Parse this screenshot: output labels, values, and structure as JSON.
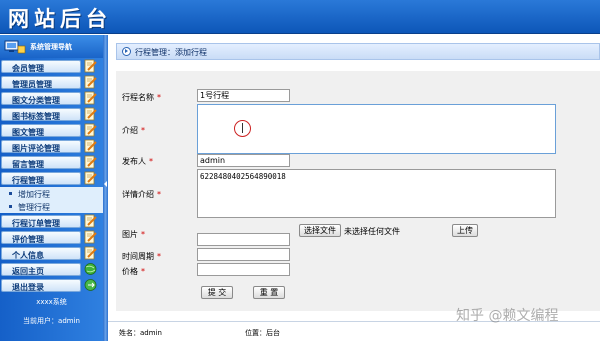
{
  "header": {
    "title": "网站后台"
  },
  "sidebar": {
    "title": "系统管理导航",
    "items": [
      {
        "label": "会员管理"
      },
      {
        "label": "管理员管理"
      },
      {
        "label": "图文分类管理"
      },
      {
        "label": "图书标签管理"
      },
      {
        "label": "图文管理"
      },
      {
        "label": "图片评论管理"
      },
      {
        "label": "留言管理"
      },
      {
        "label": "行程管理"
      }
    ],
    "sub_items": [
      {
        "label": "增加行程"
      },
      {
        "label": "管理行程"
      }
    ],
    "items_after": [
      {
        "label": "行程订单管理"
      },
      {
        "label": "评价管理"
      },
      {
        "label": "个人信息"
      },
      {
        "label": "返回主页"
      },
      {
        "label": "退出登录"
      }
    ],
    "system_name": "xxxx系统",
    "current_user": "当前用户：admin"
  },
  "breadcrumb": {
    "text": "行程管理：添加行程"
  },
  "form": {
    "name": {
      "label": "行程名称",
      "value": "1号行程"
    },
    "intro": {
      "label": "介绍",
      "value": ""
    },
    "publisher": {
      "label": "发布人",
      "value": "admin"
    },
    "detail": {
      "label": "详情介绍",
      "value": "6228480402564890018"
    },
    "image": {
      "label": "图片",
      "choose_button": "选择文件",
      "no_file": "未选择任何文件",
      "upload_button": "上传"
    },
    "period": {
      "label": "时间周期",
      "value": ""
    },
    "price": {
      "label": "价格",
      "value": ""
    },
    "submit_button": "提 交",
    "reset_button": "重 置"
  },
  "footer": {
    "name": "姓名：admin",
    "position": "位置：后台"
  },
  "watermark": "知乎 @赖文编程",
  "colors": {
    "header": "#1560c8",
    "required": "#d00000",
    "panel": "#f0f0f0"
  },
  "icons": {
    "menu_side": "document-pencil-icon",
    "return_home": "green-globe-icon",
    "logout": "green-exit-icon"
  }
}
